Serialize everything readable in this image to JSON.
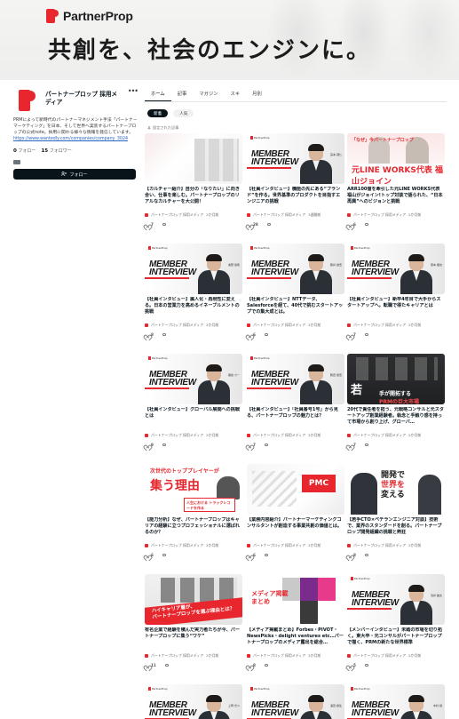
{
  "banner": {
    "brand": "PartnerProp",
    "tagline": "共創を、社会のエンジンに。"
  },
  "profile": {
    "name": "パートナープロップ 採用メディア",
    "more": "•••",
    "description": "PRMによって新時代のパートナーマネジメント手法「パートナーマーケティング」を日本、そして世界へ実装するパートナープロップの公式note。採用に関わる様々な情報を発信しています。",
    "link": "https://www.wantedly.com/companies/company_3024",
    "following_count": "0",
    "following_label": "フォロー",
    "followers_count": "15",
    "followers_label": "フォロワー",
    "follow_button": "フォロー"
  },
  "tabs": [
    "ホーム",
    "記事",
    "マガジン",
    "スキ",
    "月別"
  ],
  "chips": [
    "新着",
    "人気"
  ],
  "pinned_label": "固定された記事",
  "articles": [
    {
      "title": "【カルチャー紹介】自分の「なりたい」に向き合い、仕事を楽しむ。パートナープロップのリアルなカルチャーを大公開！",
      "author": "パートナープロップ 採用メディア",
      "time": "2か月前",
      "likes": "7",
      "comments": "",
      "thumb": "red"
    },
    {
      "title": "【社員インタビュー】機能の先にある“ブランド”を作る。世界基準のプロダクトを目指すエンジニアの挑戦",
      "author": "パートナープロップ 採用メディア",
      "time": "3週間前",
      "likes": "28",
      "comments": "",
      "thumb": "interview",
      "person_name": "宮本 飛仁"
    },
    {
      "title": "ARR100億を牽引した元LINE WORKS代表 福山がジョイン!トップ対談で語られた、“日本再興”へのビジョンと挑戦",
      "author": "パートナープロップ 採用メディア",
      "time": "2か月前",
      "likes": "6",
      "comments": "",
      "thumb": "line",
      "top_text": "「なぜ」今パートナープロップ",
      "big_text": "元LINE WORKS代表 福山ジョイン"
    },
    {
      "title": "【社員インタビュー】属人化・再現性に変える。日本の営業力を高めるイネーブルメントの挑戦",
      "author": "パートナープロップ 採用メディア",
      "time": "2か月前",
      "likes": "8",
      "comments": "",
      "thumb": "interview",
      "person_name": "奥野 俊則"
    },
    {
      "title": "【社員インタビュー】NTTデータ、Salesforceを経て、40代で挑むスタートアップでの集大成とは。",
      "author": "パートナープロップ 採用メディア",
      "time": "2か月前",
      "likes": "6",
      "comments": "",
      "thumb": "interview",
      "person_name": "藤井 健吾"
    },
    {
      "title": "【社員インタビュー】新卒4年目で大手からスタートアップへ。転職で得たキャリアとは",
      "author": "パートナープロップ 採用メディア",
      "time": "2か月前",
      "likes": "7",
      "comments": "",
      "thumb": "interview",
      "person_name": "康本 龍也"
    },
    {
      "title": "【社員インタビュー】グローバル展開への挑戦とは",
      "author": "パートナープロップ 採用メディア",
      "time": "2か月前",
      "likes": "9",
      "comments": "",
      "thumb": "interview",
      "person_name": "黒岩 カー"
    },
    {
      "title": "【社員インタビュー】「社員番号1号」から見る、パートナープロップの魅力とは？",
      "author": "パートナープロップ 採用メディア",
      "time": "2か月前",
      "likes": "7",
      "comments": "",
      "thumb": "interview",
      "person_name": "鶴田 啓吾"
    },
    {
      "title": "20代で責任者を担う、元戦略コンサルと元スタートアップ創業経験者。執念と手触り感を持って市場から創り上げ、グローバ…",
      "author": "パートナープロップ 採用メディア",
      "time": "2か月前",
      "likes": "7",
      "comments": "",
      "thumb": "dark",
      "big_text": "若",
      "sub_a": "手が開拓する",
      "sub_b": "PRMの巨大市場"
    },
    {
      "title": "【能力分析】なぜ、パートナープロップはキャリアの経験に立つプロフェッショナルに選ばれるのか？",
      "author": "パートナープロップ 採用メディア",
      "time": "2か月前",
      "likes": "6",
      "comments": "",
      "thumb": "poster",
      "head_text": "次世代のトッププレイヤーが",
      "big_text": "集う理由",
      "box_text": "人生における トラックレコードを作る"
    },
    {
      "title": "【業務内容紹介】パートナーマーケティングコンサルタントが創造する事業共創の価値とは。",
      "author": "パートナープロップ 採用メディア",
      "time": "2か月前",
      "likes": "6",
      "comments": "",
      "thumb": "pmc",
      "pmc_text": "PMC"
    },
    {
      "title": "【若手CTO×ベテランエンジニア対談】技術で、業界のスタンダードを創る。パートナープロップ開発組織の挑戦と熱狂",
      "author": "パートナープロップ 採用メディア",
      "time": "2か月前",
      "likes": "8",
      "comments": "",
      "thumb": "dev",
      "dev_a": "開発で",
      "dev_b": "世界を",
      "dev_c": "変える"
    },
    {
      "title": "有名企業で経験を積んだ実力者たちが今、パートナープロップに集う“ワケ”",
      "author": "パートナープロップ 採用メディア",
      "time": "2か月前",
      "likes": "11",
      "comments": "",
      "thumb": "high",
      "band_a": "ハイキャリア層が、",
      "band_b": "パートナープロップを選ぶ理由とは？"
    },
    {
      "title": "【メディア掲載まとめ】Forbes・PIVOT・NewsPicks・delight ventures etc…パートナープロップのメディア露出を総合…",
      "author": "パートナープロップ 採用メディア",
      "time": "2か月前",
      "likes": "8",
      "comments": "",
      "thumb": "media",
      "media_a": "メディア掲載",
      "media_b": "まとめ"
    },
    {
      "title": "【メンバーインタビュー】未踏の市場を切り拓く。東大卒・元コンサルがパートナープロップで描く、PRMの新たな世界標準",
      "author": "パートナープロップ 採用メディア",
      "time": "2か月前",
      "likes": "5",
      "comments": "",
      "thumb": "interview",
      "person_name": "浅井 雄太"
    },
    {
      "title": "",
      "author": "",
      "time": "",
      "likes": "",
      "comments": "",
      "thumb": "interview",
      "person_name": "上岡 光斗"
    },
    {
      "title": "",
      "author": "",
      "time": "",
      "likes": "",
      "comments": "",
      "thumb": "interview",
      "person_name": "澤田 樹生"
    },
    {
      "title": "",
      "author": "",
      "time": "",
      "likes": "",
      "comments": "",
      "thumb": "interview",
      "person_name": "中村 健"
    }
  ],
  "thumb_common": {
    "logo": "PartnerProp",
    "member_a": "MEMBER",
    "member_b": "INTERVIEW"
  },
  "colors": {
    "accent": "#e8262d",
    "ink": "#08131a"
  }
}
